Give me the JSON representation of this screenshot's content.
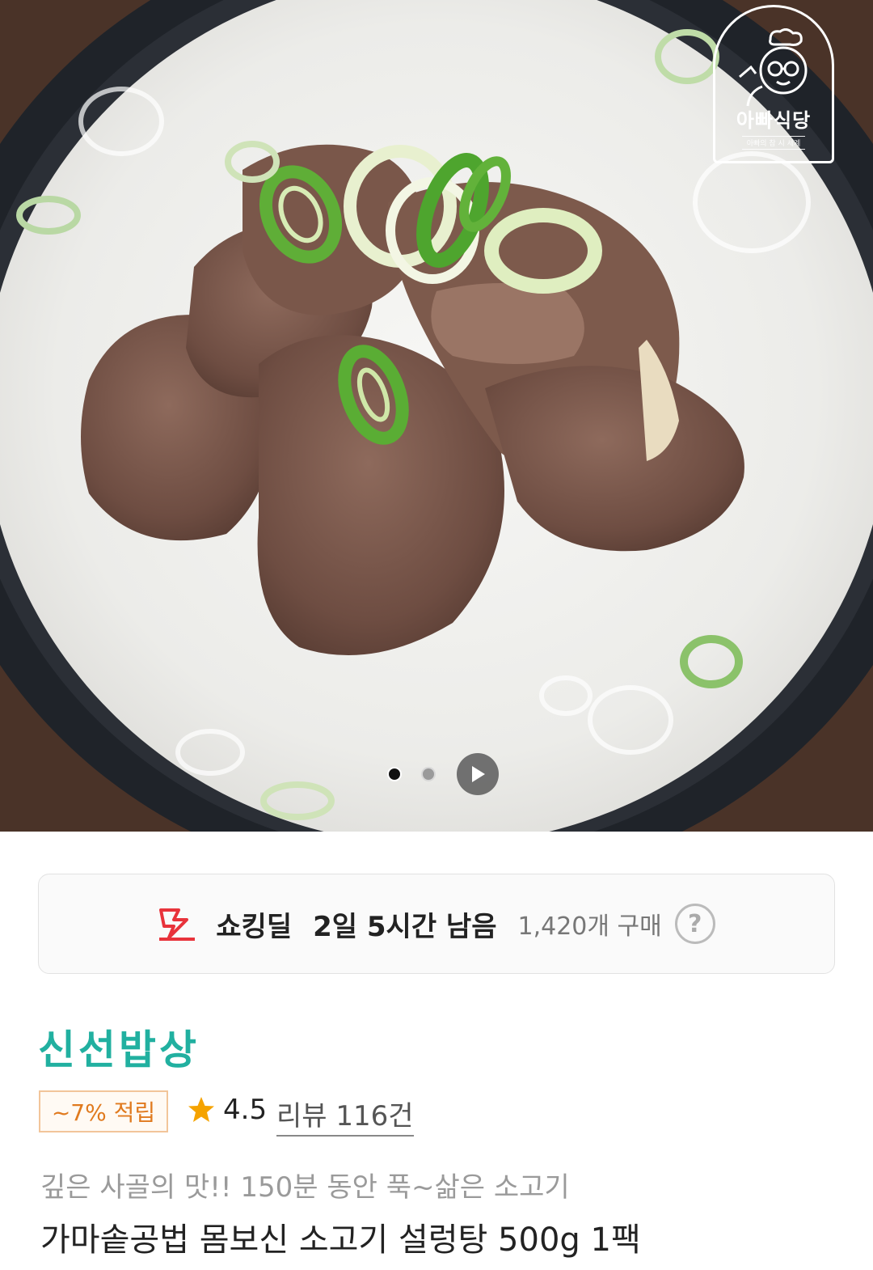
{
  "hero": {
    "logo": {
      "name": "아빠식당",
      "tagline": "아빠의 참 시 세계"
    },
    "carousel": {
      "total_slides": 2,
      "active_index": 0
    }
  },
  "deal": {
    "label": "쇼킹딜",
    "time_left": "2일 5시간 남음",
    "purchase_count": "1,420개 구매",
    "help": "?"
  },
  "product": {
    "brand": "신선밥상",
    "reward": "~7% 적립",
    "rating": "4.5",
    "reviews": "리뷰 116건",
    "subtitle": "깊은 사골의 맛!! 150분 동안 푹~삶은 소고기",
    "title": "가마솥공법 몸보신 소고기 설렁탕 500g 1팩"
  },
  "colors": {
    "brand": "#21b0a0",
    "deal_icon": "#e8333b",
    "reward": "#e07a1f",
    "star": "#f5a300"
  }
}
